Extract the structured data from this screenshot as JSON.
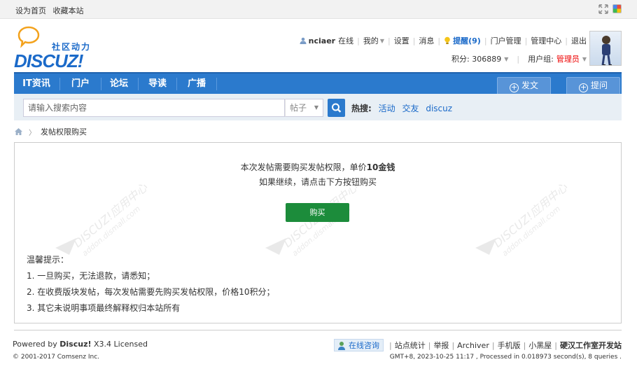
{
  "topbar": {
    "set_home": "设为首页",
    "bookmark": "收藏本站",
    "expand_icon": "expand-arrows-icon",
    "style_icon": "color-palette-icon"
  },
  "logo": {
    "community": "社区动力",
    "brand": "DISCUZ!"
  },
  "user": {
    "name": "nciaer",
    "online": "在线",
    "mine": "我的",
    "settings": "设置",
    "messages": "消息",
    "remind": "提醒(9)",
    "portal_manage": "门户管理",
    "admin_center": "管理中心",
    "logout": "退出",
    "credits": "积分: 306889",
    "usergroup_label": "用户组:",
    "usergroup": "管理员"
  },
  "nav": {
    "items": [
      "IT资讯",
      "门户",
      "论坛",
      "导读",
      "广播"
    ],
    "post_button": "发文",
    "ask_button": "提问"
  },
  "search": {
    "placeholder": "请输入搜索内容",
    "scope": "帖子",
    "hot_label": "热搜:",
    "hot_tags": [
      "活动",
      "交友",
      "discuz"
    ]
  },
  "breadcrumb": {
    "current": "发帖权限购买"
  },
  "main": {
    "line1_prefix": "本次发帖需要购买发帖权限，单价",
    "line1_price": "10金钱",
    "line2": "如果继续，请点击下方按钮购买",
    "buy_button": "购买",
    "tips_title": "温馨提示：",
    "tips": [
      "1. 一旦购买，无法退款，请悉知；",
      "2. 在收费版块发帖，每次发帖需要先购买发帖权限，价格10积分；",
      "3. 其它未说明事项最终解释权归本站所有"
    ]
  },
  "footer": {
    "powered_prefix": "Powered by",
    "powered_brand": "Discuz!",
    "version": "X3.4 Licensed",
    "copyright": "© 2001-2017 Comsenz Inc.",
    "consult": "在线咨询",
    "links": [
      "站点统计",
      "举报",
      "Archiver",
      "手机版",
      "小黑屋"
    ],
    "studio": "硬汉工作室开发站",
    "stats": "GMT+8, 2023-10-25 11:17 , Processed in 0.018973 second(s), 8 queries ."
  },
  "colors": {
    "nav_blue": "#2b7acd",
    "buy_green": "#1c8c3b",
    "admin_red": "#ee0000",
    "link_blue": "#1b6ac9"
  }
}
